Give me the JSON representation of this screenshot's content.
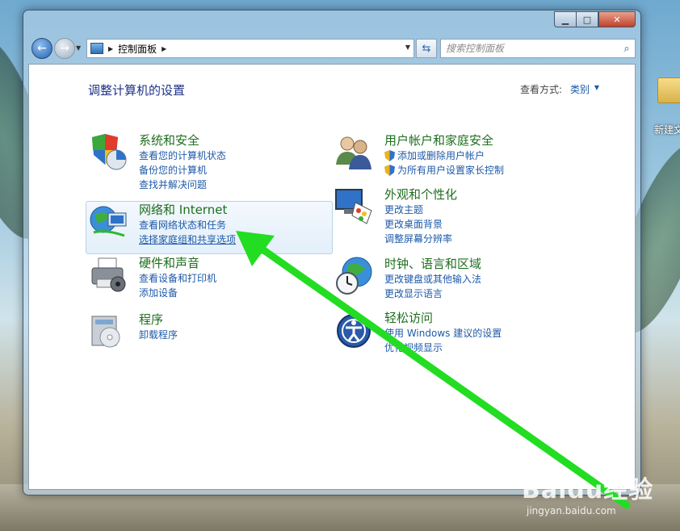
{
  "window": {
    "caption": {
      "minimize": "▁",
      "maximize": "□",
      "close": "✕"
    }
  },
  "navigation": {
    "breadcrumb": [
      "控制面板"
    ],
    "search_placeholder": "搜索控制面板"
  },
  "content": {
    "title": "调整计算机的设置",
    "view_by_label": "查看方式:",
    "view_by_value": "类别"
  },
  "categories": [
    {
      "title": "系统和安全",
      "icon": "shield-pie-icon",
      "links": [
        "查看您的计算机状态",
        "备份您的计算机",
        "查找并解决问题"
      ]
    },
    {
      "title": "网络和 Internet",
      "icon": "network-globe-icon",
      "links": [
        "查看网络状态和任务",
        "选择家庭组和共享选项"
      ]
    },
    {
      "title": "硬件和声音",
      "icon": "printer-icon",
      "links": [
        "查看设备和打印机",
        "添加设备"
      ]
    },
    {
      "title": "程序",
      "icon": "programs-disc-icon",
      "links": [
        "卸载程序"
      ]
    },
    {
      "title": "用户帐户和家庭安全",
      "icon": "users-icon",
      "links": [
        "添加或删除用户帐户",
        "为所有用户设置家长控制"
      ]
    },
    {
      "title": "外观和个性化",
      "icon": "monitor-palette-icon",
      "links": [
        "更改主题",
        "更改桌面背景",
        "调整屏幕分辨率"
      ]
    },
    {
      "title": "时钟、语言和区域",
      "icon": "clock-globe-icon",
      "links": [
        "更改键盘或其他输入法",
        "更改显示语言"
      ]
    },
    {
      "title": "轻松访问",
      "icon": "ease-of-access-icon",
      "links": [
        "使用 Windows 建议的设置",
        "优化视频显示"
      ]
    }
  ],
  "desktop": {
    "folder_label": "新建文"
  },
  "watermark": {
    "brand": "Baidu经验",
    "site": "jingyan.baidu.com"
  },
  "colors": {
    "arrow": "#22dd22",
    "link": "#1e5aa8",
    "category_title": "#1e6e1e"
  }
}
